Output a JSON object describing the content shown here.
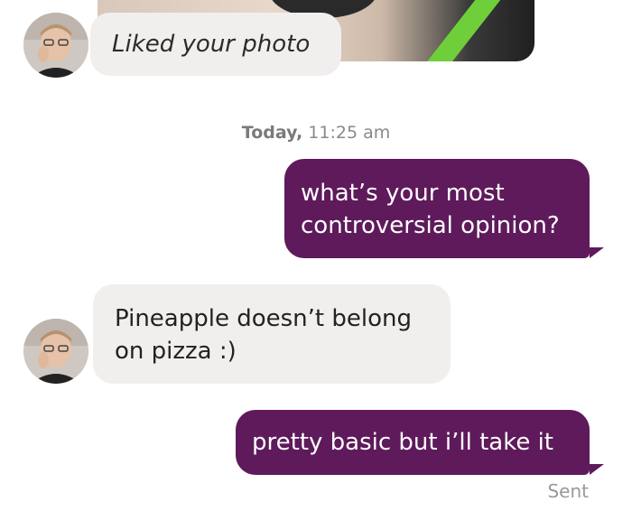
{
  "liked": {
    "text": "Liked your photo"
  },
  "timestamp": {
    "day": "Today,",
    "time": " 11:25 am"
  },
  "messages": [
    {
      "from": "me",
      "lines": [
        "what’s your most",
        "controversial opinion?"
      ]
    },
    {
      "from": "them",
      "lines": [
        "Pineapple doesn’t belong",
        "on pizza :)"
      ]
    },
    {
      "from": "me",
      "lines": [
        "pretty basic but i’ll take it"
      ]
    }
  ],
  "status": {
    "sent": "Sent"
  },
  "colors": {
    "sent_bubble": "#5e1a5b",
    "received_bubble": "#f1efee",
    "timestamp_text": "#8a8a8a"
  },
  "icons": {
    "avatar": "user-avatar-photo"
  }
}
